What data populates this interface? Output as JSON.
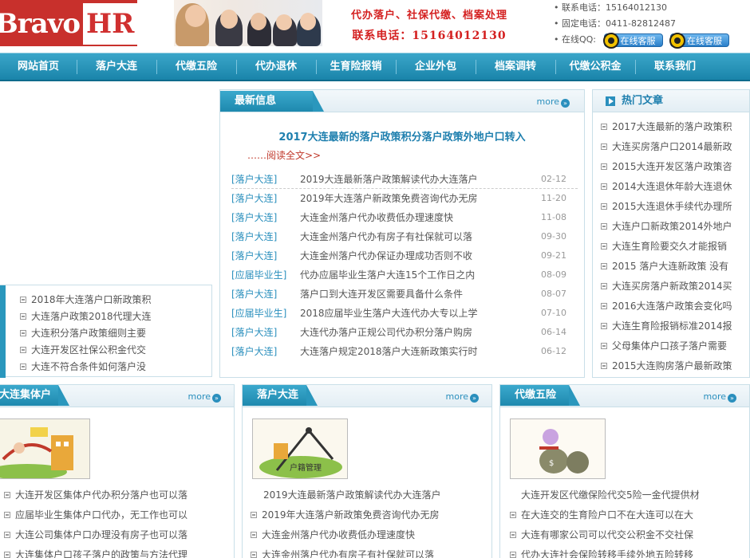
{
  "header": {
    "logo_left": "Bravo",
    "logo_right": "HR",
    "slogan_line1": "代办落户、社保代缴、档案处理",
    "slogan_line2": "联系电话：15164012130",
    "contact_phone": "• 联系电话：15164012130",
    "contact_fixed": "• 固定电话：0411-82812487",
    "contact_qq_label": "• 在线QQ:",
    "qq_button_1": "在线客服",
    "qq_button_2": "在线客服"
  },
  "nav": {
    "items": [
      "网站首页",
      "落户大连",
      "代缴五险",
      "代办退休",
      "生育险报销",
      "企业外包",
      "档案调转",
      "代缴公积金",
      "联系我们"
    ]
  },
  "latest": {
    "title": "最新信息",
    "more": "more",
    "feature_title": "2017大连最新的落户政策积分落户政策外地户口转入",
    "read_more": "……阅读全文>>",
    "items": [
      {
        "cat": "[落户大连]",
        "title": "2019大连最新落户政策解读代办大连落户",
        "date": "02-12"
      },
      {
        "cat": "[落户大连]",
        "title": "2019年大连落户新政策免费咨询代办无房",
        "date": "11-20"
      },
      {
        "cat": "[落户大连]",
        "title": "大连金州落户代办收费低办理速度快",
        "date": "11-08"
      },
      {
        "cat": "[落户大连]",
        "title": "大连金州落户代办有房子有社保就可以落",
        "date": "09-30"
      },
      {
        "cat": "[落户大连]",
        "title": "大连金州落户代办保证办理成功否则不收",
        "date": "09-21"
      },
      {
        "cat": "[应届毕业生]",
        "title": "代办应届毕业生落户大连15个工作日之内",
        "date": "08-09"
      },
      {
        "cat": "[落户大连]",
        "title": "落户口到大连开发区需要具备什么条件",
        "date": "08-07"
      },
      {
        "cat": "[应届毕业生]",
        "title": "2018应届毕业生落户大连代办大专以上学",
        "date": "07-10"
      },
      {
        "cat": "[落户大连]",
        "title": "大连代办落户正规公司代办积分落户购房",
        "date": "06-14"
      },
      {
        "cat": "[落户大连]",
        "title": "大连落户规定2018落户大连新政策实行时",
        "date": "06-12"
      }
    ]
  },
  "hot": {
    "title": "热门文章",
    "items": [
      "2017大连最新的落户政策积",
      "大连买房落户口2014最新政",
      "2015大连开发区落户政策咨",
      "2014大连退休年龄大连退休",
      "2015大连退休手续代办理所",
      "大连户口新政策2014外地户",
      "大连生育险要交久才能报销",
      "2015 落户大连新政策 没有",
      "大连买房落户新政策2014买",
      "2016大连落户政策会变化吗",
      "大连生育险报销标准2014报",
      "父母集体户口孩子落户需要",
      "2015大连购房落户最新政策"
    ]
  },
  "left_box": {
    "items": [
      "2018年大连落户口新政策积",
      "大连落户政策2018代理大连",
      "大连积分落户政策细则主要",
      "大连开发区社保公积金代交",
      "大连不符合条件如何落户没"
    ]
  },
  "panel_jiti": {
    "title": "大连集体户",
    "more": "more",
    "items": [
      "大连开发区集体户代办积分落户也可以落",
      "应届毕业生集体户口代办，无工作也可以",
      "大连公司集体户口办理没有房子也可以落",
      "大连集体户口孩子落户的政策与方法代理"
    ]
  },
  "panel_luohu": {
    "title": "落户大连",
    "more": "more",
    "thumb_label": "户籍管理",
    "items": [
      "2019大连最新落户政策解读代办大连落户",
      "2019年大连落户新政策免费咨询代办无房",
      "大连金州落户代办收费低办理速度快",
      "大连金州落户代办有房子有社保就可以落"
    ]
  },
  "panel_wuxian": {
    "title": "代缴五险",
    "more": "more",
    "items": [
      "大连开发区代缴保险代交5险一金代提供材",
      "在大连交的生育险户口不在大连可以在大",
      "大连有哪家公司可以代交公积金不交社保",
      "代办大连社会保险转移手续外地五险转移"
    ]
  },
  "colors": {
    "nav_blue": "#1a84aa",
    "link_blue": "#2a8fbd",
    "brand_red": "#c8302c",
    "slogan_red": "#d42020"
  }
}
